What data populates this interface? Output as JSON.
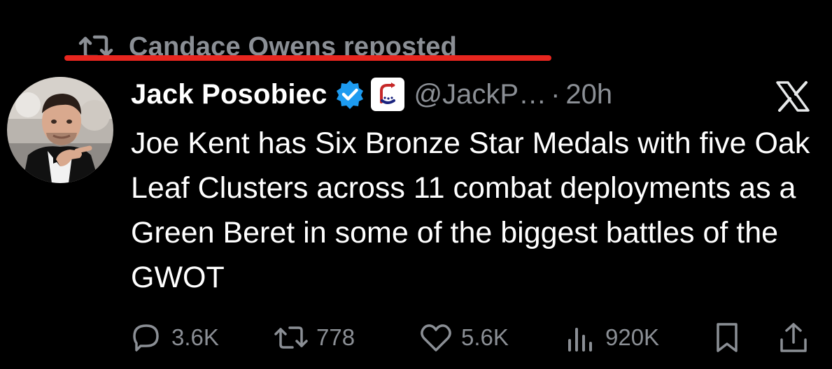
{
  "repost": {
    "label": "Candace Owens reposted",
    "highlight_color": "#e8261f"
  },
  "author": {
    "display_name": "Jack Posobiec",
    "handle": "@JackP…",
    "separator": "·",
    "time": "20h",
    "verified_badge_color": "#1d9bf0",
    "affiliate_badge": "bookmark-arrow-logo"
  },
  "post": {
    "text": "Joe Kent has Six Bronze Star Medals with five Oak Leaf Clusters across 11 combat deployments as a Green Beret in some of the biggest battles of the GWOT"
  },
  "actions": {
    "replies": "3.6K",
    "reposts": "778",
    "likes": "5.6K",
    "views": "920K"
  },
  "icons": {
    "repost": "repost-icon",
    "reply": "reply-icon",
    "like": "heart-icon",
    "views": "views-icon",
    "bookmark": "bookmark-icon",
    "share": "share-icon",
    "x_logo": "x-logo-icon"
  }
}
